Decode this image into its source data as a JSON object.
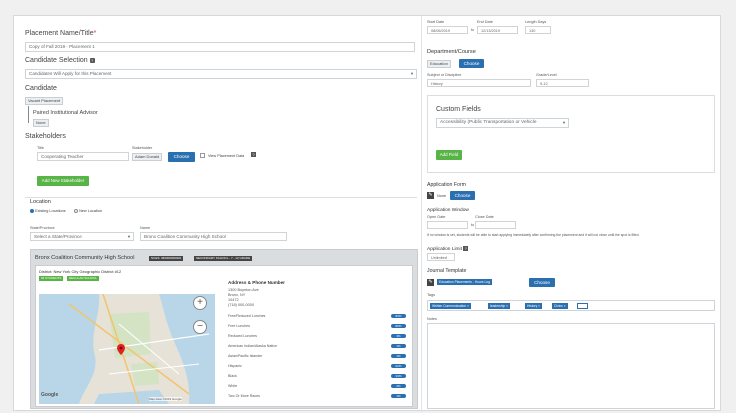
{
  "placement": {
    "name_label": "Placement Name/Title",
    "name_required": "*",
    "name_value": "Copy of Fall 2019 - Placement 1"
  },
  "candidate_selection": {
    "label": "Candidate Selection",
    "value": "Candidates Will Apply for this Placement"
  },
  "candidate": {
    "label": "Candidate",
    "vacant_tag": "Vacant Placement",
    "paired_advisor_label": "Paired Institutional Advisor",
    "none_tag": "None"
  },
  "stakeholders": {
    "label": "Stakeholders",
    "title_label": "Title",
    "title_value": "Cooperating Teacher",
    "stakeholder_label": "Stakeholder",
    "stakeholder_value": "Adam Donald",
    "choose_label": "Choose",
    "view_placement_data_label": "View Placement Data",
    "add_button": "Add New Stakeholder"
  },
  "location": {
    "label": "Location",
    "option_existing": "Existing Locations",
    "option_new": "New Location",
    "state_label": "State/Province",
    "state_value": "Select a State/Province",
    "name_label": "Name",
    "name_value": "Bronx Coalition Community High School"
  },
  "school": {
    "name": "Bronx Coalition Community High School",
    "badge_1": "NCES: 360000000000",
    "badge_2": "SECONDARY SCHOOL - 7 - 12 GRADE",
    "district": "District: New York City Geographic District #12",
    "badge_students": "92 STUDENTS",
    "badge_regular": "REGULAR SCHOOL",
    "address_title": "Address & Phone Number",
    "address_lines": [
      "1300 Boynton Ave",
      "Bronx, NY",
      "10472",
      "(718) 000-0000"
    ],
    "stats": [
      {
        "label": "Free/Reduced Lunches",
        "value": "83%"
      },
      {
        "label": "Free Lunches",
        "value": "80%"
      },
      {
        "label": "Reduced Lunches",
        "value": "3%"
      },
      {
        "label": "American Indian/Alaska Native",
        "value": "1%"
      },
      {
        "label": "Asian/Pacific Islander",
        "value": "1%"
      },
      {
        "label": "Hispanic",
        "value": "62%"
      },
      {
        "label": "Black",
        "value": "33%"
      },
      {
        "label": "White",
        "value": "2%"
      },
      {
        "label": "Two Or More Races",
        "value": "1%"
      }
    ],
    "map_zoom_in": "+",
    "map_zoom_out": "−",
    "map_logo": "Google",
    "map_footer": "Map data ©2019 Google"
  },
  "dates": {
    "start_label": "Start Date",
    "start_value": "08/06/2019",
    "separator": "to",
    "end_label": "End Date",
    "end_value": "12/13/2019",
    "length_label": "Length Days",
    "length_value": "130"
  },
  "department": {
    "label": "Department/Course",
    "value_tag": "Education",
    "choose_label": "Choose",
    "subject_label": "Subject or Discipline",
    "subject_value": "History",
    "grade_label": "Grade/Level",
    "grade_value": "9-12"
  },
  "custom_fields": {
    "label": "Custom Fields",
    "select_value": "Accessibility (Public Transportation or Vehicle",
    "add_button": "Add Field"
  },
  "application_form": {
    "label": "Application Form",
    "value": "None",
    "choose_label": "Choose"
  },
  "application_window": {
    "label": "Application Window",
    "open_label": "Open Date",
    "close_label": "Close Date",
    "separator": "to",
    "note": "If no window is set, students will be able to start applying immediately after confirming the placement and it will not close until the spot is filled."
  },
  "application_limit": {
    "label": "Application Limit",
    "value": "Unlimited"
  },
  "journal": {
    "label": "Journal Template",
    "value": "Education Placements - Hours Log",
    "choose_label": "Choose"
  },
  "tags": {
    "label": "Tags",
    "items": [
      "Written Communication",
      "leadership",
      "History",
      "Civics"
    ]
  },
  "notes": {
    "label": "Notes"
  }
}
